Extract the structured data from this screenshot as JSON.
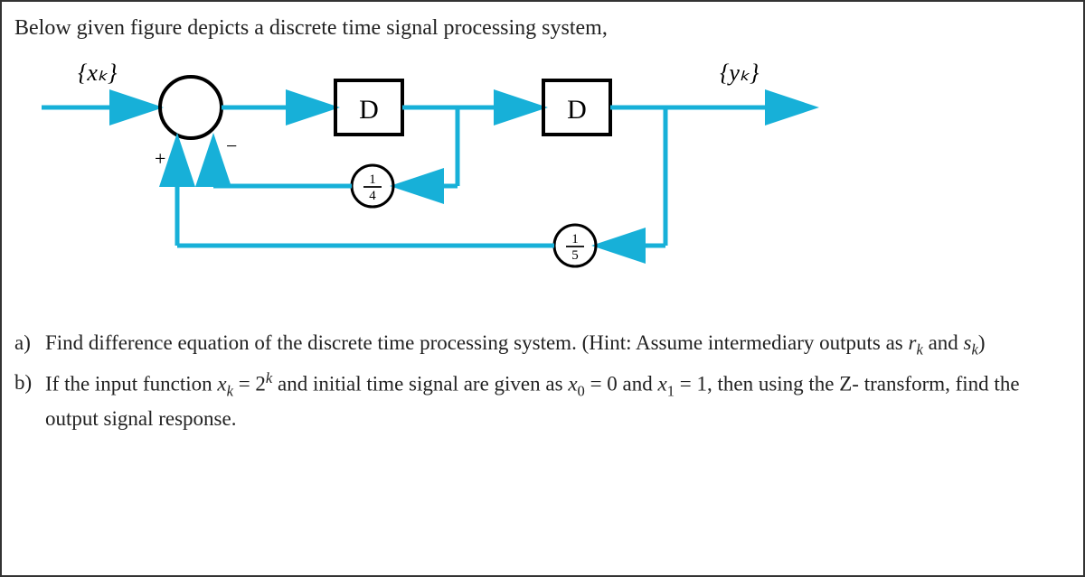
{
  "prompt": "Below given figure depicts a discrete time signal processing system,",
  "diagram": {
    "input_label": "{xₖ}",
    "output_label": "{yₖ}",
    "delay1": "D",
    "delay2": "D",
    "gain_minus": "¼",
    "gain_plus_bottom": "⅕",
    "gain_minus_text": "1/4",
    "gain_bottom_text": "1/5",
    "summing_plus": "+",
    "summing_minus": "−"
  },
  "questions": {
    "a_label": "a)",
    "a_text_1": "Find difference equation of the discrete time processing system. (Hint: Assume intermediary outputs as ",
    "a_rk": "r",
    "a_rk_sub": "k",
    "a_mid": " and ",
    "a_sk": "s",
    "a_sk_sub": "k",
    "a_close": ")",
    "b_label": "b)",
    "b_1": "If the input function ",
    "b_xk": "x",
    "b_xk_sub": "k",
    "b_eq1": " = 2",
    "b_exp": "k",
    "b_2": " and initial time signal are given as ",
    "b_x0": "x",
    "b_x0_sub": "0",
    "b_eq0": " = 0 and ",
    "b_x1": "x",
    "b_x1_sub": "1",
    "b_eq1b": " = 1, then using the Z- transform, find the output signal response."
  }
}
